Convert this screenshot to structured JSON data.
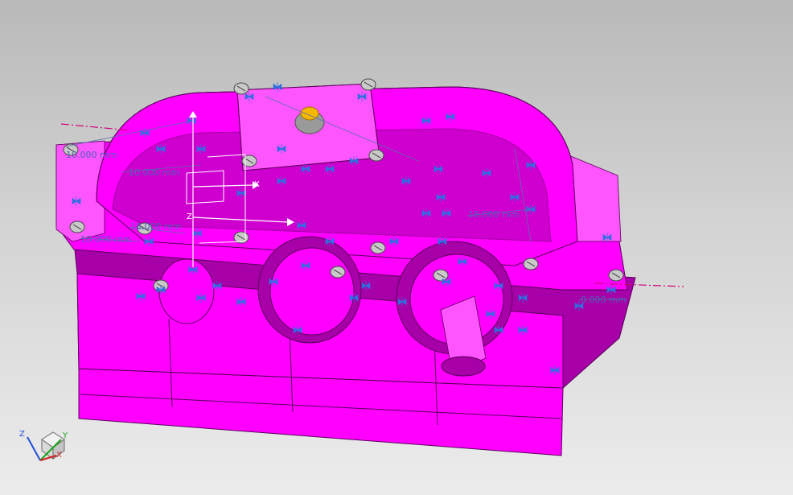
{
  "window": {
    "background_top": "#b9b9b9",
    "background_bottom": "#ececec"
  },
  "model": {
    "body_color": "#ff00ff",
    "edge_color": "#5a005a",
    "shade_color": "#a800a8",
    "highlight_color": "#ff55ff",
    "vent_cap_color": "#f5b800",
    "bolt_color": "#c9c9c9"
  },
  "constraints": {
    "symbol_color": "#2f6fe0",
    "centerline_color": "#d0007a"
  },
  "dimensions": [
    {
      "id": "dim-1",
      "text": "10.000 mm"
    },
    {
      "id": "dim-2",
      "text": "10.000 mm"
    },
    {
      "id": "dim-3",
      "text": "18.000 mm"
    },
    {
      "id": "dim-4",
      "text": "10.000 mm"
    },
    {
      "id": "dim-5",
      "text": "18.000 mm"
    },
    {
      "id": "dim-6",
      "text": "0.000 mm"
    }
  ],
  "wcs": {
    "x_label": "X",
    "z_label": "Z"
  },
  "view_triad": {
    "x_label": "X",
    "y_label": "Y",
    "z_label": "Z",
    "x_color": "#d42020",
    "y_color": "#1aa01a",
    "z_color": "#2050d8"
  }
}
